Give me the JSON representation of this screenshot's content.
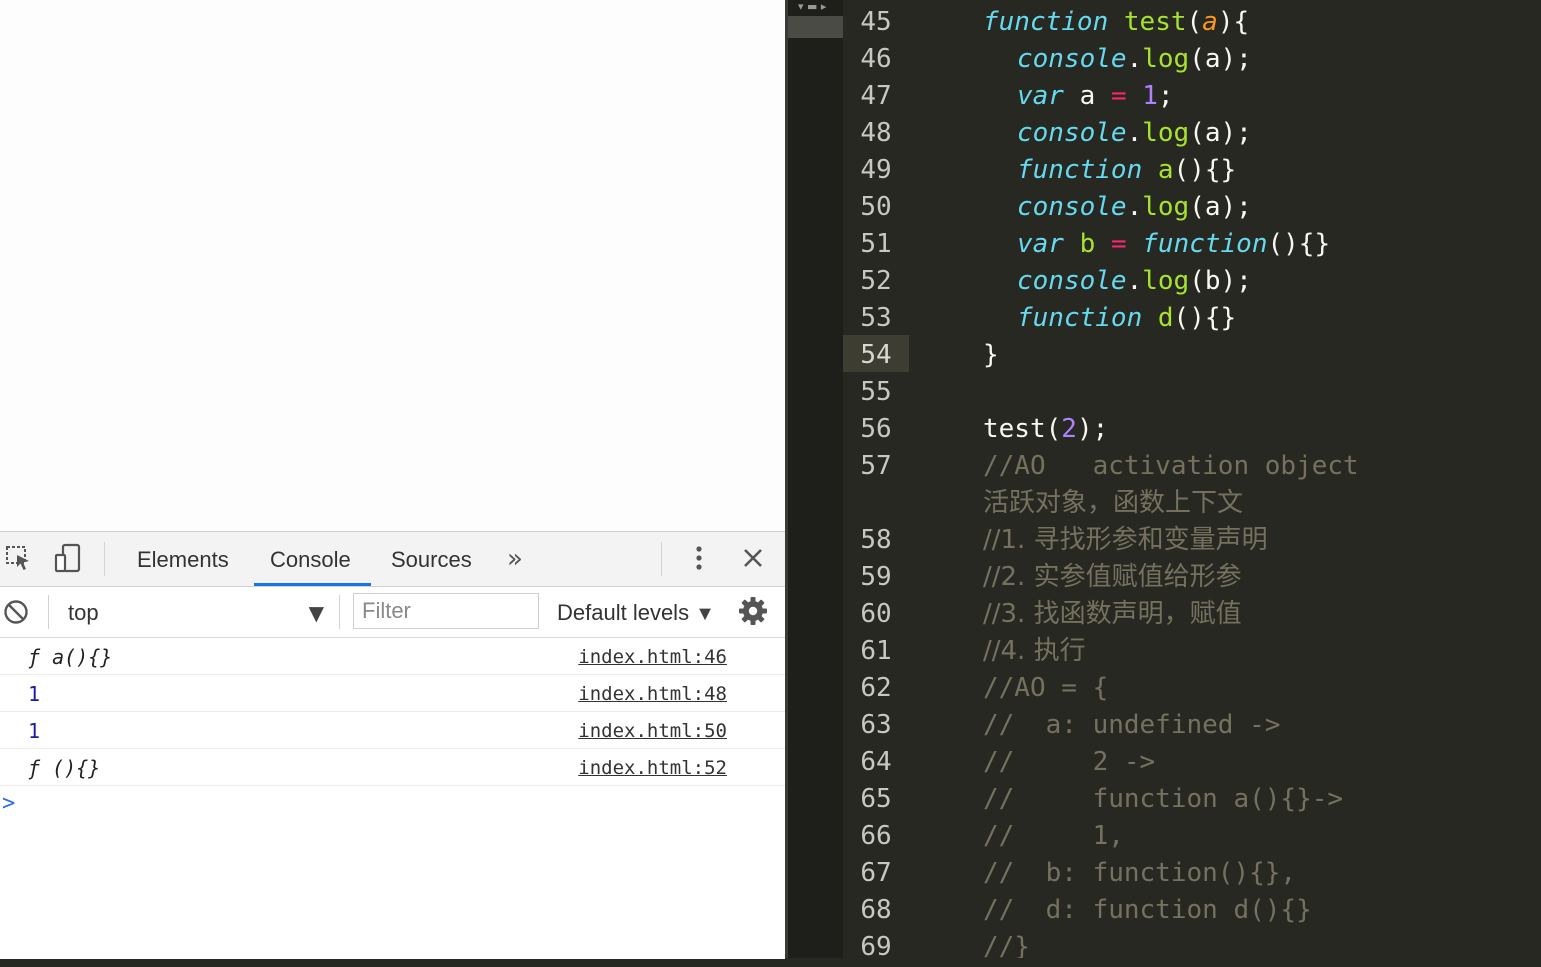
{
  "devtools": {
    "tabs": [
      "Elements",
      "Console",
      "Sources"
    ],
    "active_tab": "Console",
    "more_tabs_label": "»",
    "context": "top",
    "filter_placeholder": "Filter",
    "levels_label": "Default levels",
    "prompt_symbol": ">",
    "logs": [
      {
        "msg": "ƒ a(){}",
        "kind": "func",
        "src": "index.html:46"
      },
      {
        "msg": "1",
        "kind": "num",
        "src": "index.html:48"
      },
      {
        "msg": "1",
        "kind": "num",
        "src": "index.html:50"
      },
      {
        "msg": "ƒ (){}",
        "kind": "func",
        "src": "index.html:52"
      }
    ]
  },
  "editor": {
    "current_line": "54",
    "lines": [
      {
        "n": "45",
        "parts": [
          [
            "kw",
            "function"
          ],
          [
            "t",
            " "
          ],
          [
            "fn",
            "test"
          ],
          [
            "t",
            "("
          ],
          [
            "param",
            "a"
          ],
          [
            "t",
            "){"
          ]
        ],
        "indent": 2
      },
      {
        "n": "46",
        "parts": [
          [
            "kw",
            "console"
          ],
          [
            "t",
            "."
          ],
          [
            "fn",
            "log"
          ],
          [
            "t",
            "(a);"
          ]
        ],
        "indent": 3
      },
      {
        "n": "47",
        "parts": [
          [
            "kw",
            "var"
          ],
          [
            "t",
            " a "
          ],
          [
            "op",
            "="
          ],
          [
            "t",
            " "
          ],
          [
            "num",
            "1"
          ],
          [
            "t",
            ";"
          ]
        ],
        "indent": 3
      },
      {
        "n": "48",
        "parts": [
          [
            "kw",
            "console"
          ],
          [
            "t",
            "."
          ],
          [
            "fn",
            "log"
          ],
          [
            "t",
            "(a);"
          ]
        ],
        "indent": 3
      },
      {
        "n": "49",
        "parts": [
          [
            "kw",
            "function"
          ],
          [
            "t",
            " "
          ],
          [
            "fn",
            "a"
          ],
          [
            "t",
            "(){}"
          ]
        ],
        "indent": 3
      },
      {
        "n": "50",
        "parts": [
          [
            "kw",
            "console"
          ],
          [
            "t",
            "."
          ],
          [
            "fn",
            "log"
          ],
          [
            "t",
            "(a);"
          ]
        ],
        "indent": 3
      },
      {
        "n": "51",
        "parts": [
          [
            "kw",
            "var"
          ],
          [
            "t",
            " "
          ],
          [
            "fn",
            "b"
          ],
          [
            "t",
            " "
          ],
          [
            "op",
            "="
          ],
          [
            "t",
            " "
          ],
          [
            "kw",
            "function"
          ],
          [
            "t",
            "(){}"
          ]
        ],
        "indent": 3
      },
      {
        "n": "52",
        "parts": [
          [
            "kw",
            "console"
          ],
          [
            "t",
            "."
          ],
          [
            "fn",
            "log"
          ],
          [
            "t",
            "(b);"
          ]
        ],
        "indent": 3
      },
      {
        "n": "53",
        "parts": [
          [
            "kw",
            "function"
          ],
          [
            "t",
            " "
          ],
          [
            "fn",
            "d"
          ],
          [
            "t",
            "(){}"
          ]
        ],
        "indent": 3
      },
      {
        "n": "54",
        "parts": [
          [
            "t",
            "}"
          ]
        ],
        "indent": 2
      },
      {
        "n": "55",
        "parts": [],
        "indent": 0
      },
      {
        "n": "56",
        "parts": [
          [
            "t",
            "test("
          ],
          [
            "num",
            "2"
          ],
          [
            "t",
            ");"
          ]
        ],
        "indent": 2
      },
      {
        "n": "57",
        "parts": [
          [
            "cm",
            "//AO   activation object"
          ]
        ],
        "indent": 2
      },
      {
        "n": "",
        "parts": [
          [
            "cm",
            "活跃对象，函数上下文"
          ]
        ],
        "indent": 2,
        "cjk": true
      },
      {
        "n": "58",
        "parts": [
          [
            "cm",
            "//1. 寻找形参和变量声明"
          ]
        ],
        "indent": 2,
        "cjk": true
      },
      {
        "n": "59",
        "parts": [
          [
            "cm",
            "//2. 实参值赋值给形参"
          ]
        ],
        "indent": 2,
        "cjk": true
      },
      {
        "n": "60",
        "parts": [
          [
            "cm",
            "//3. 找函数声明，赋值"
          ]
        ],
        "indent": 2,
        "cjk": true
      },
      {
        "n": "61",
        "parts": [
          [
            "cm",
            "//4. 执行"
          ]
        ],
        "indent": 2,
        "cjk": true
      },
      {
        "n": "62",
        "parts": [
          [
            "cm",
            "//AO = {"
          ]
        ],
        "indent": 2
      },
      {
        "n": "63",
        "parts": [
          [
            "cm",
            "//  a: undefined ->"
          ]
        ],
        "indent": 2
      },
      {
        "n": "64",
        "parts": [
          [
            "cm",
            "//     2 ->"
          ]
        ],
        "indent": 2
      },
      {
        "n": "65",
        "parts": [
          [
            "cm",
            "//     function a(){}->"
          ]
        ],
        "indent": 2
      },
      {
        "n": "66",
        "parts": [
          [
            "cm",
            "//     1,"
          ]
        ],
        "indent": 2
      },
      {
        "n": "67",
        "parts": [
          [
            "cm",
            "//  b: function(){},"
          ]
        ],
        "indent": 2
      },
      {
        "n": "68",
        "parts": [
          [
            "cm",
            "//  d: function d(){}"
          ]
        ],
        "indent": 2
      },
      {
        "n": "69",
        "parts": [
          [
            "cm",
            "//}"
          ]
        ],
        "indent": 2
      }
    ]
  }
}
